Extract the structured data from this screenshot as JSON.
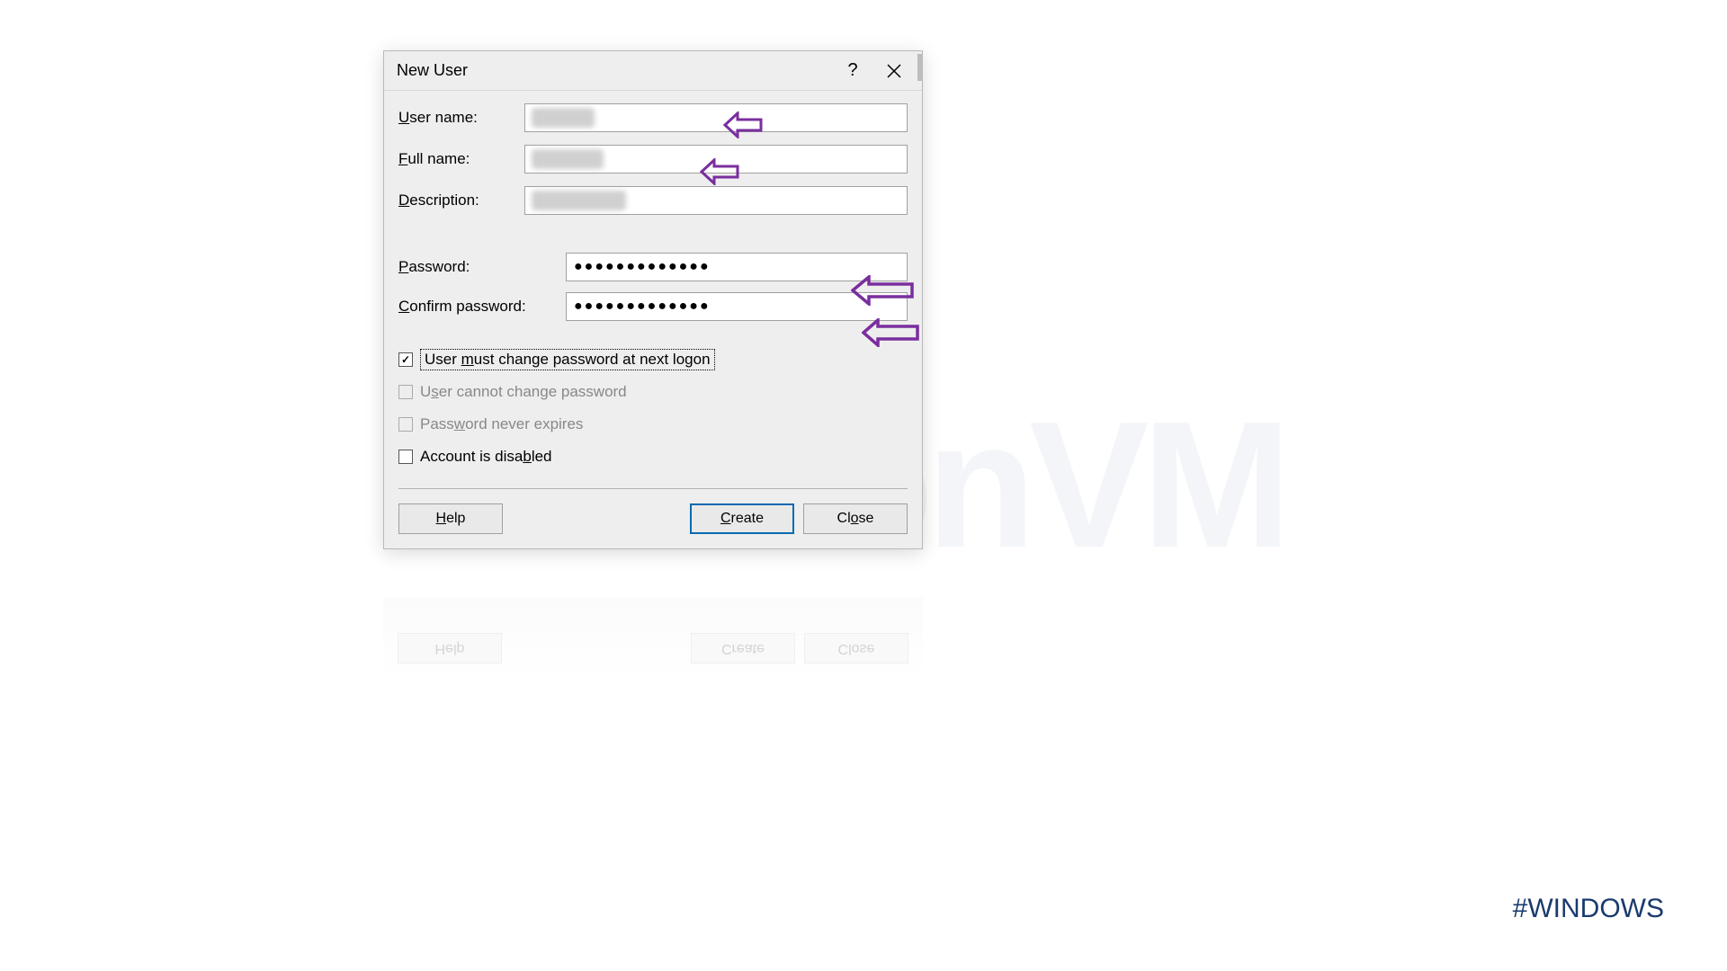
{
  "watermark": "NeuronVM",
  "hashtag": "#WINDOWS",
  "dialog": {
    "title": "New User",
    "fields": {
      "username_label": "User name:",
      "username_mnemonic": "U",
      "fullname_label": "Full name:",
      "fullname_mnemonic": "F",
      "description_label": "Description:",
      "description_mnemonic": "D",
      "password_label": "Password:",
      "password_mnemonic": "P",
      "confirm_label": "Confirm password:",
      "confirm_mnemonic": "C",
      "password_value": "●●●●●●●●●●●●●",
      "confirm_value": "●●●●●●●●●●●●●"
    },
    "checkboxes": {
      "must_change": {
        "label": "User must change password at next logon",
        "mnemonic": "m",
        "checked": true,
        "disabled": false,
        "focused": true
      },
      "cannot_change": {
        "label": "User cannot change password",
        "mnemonic": "s",
        "checked": false,
        "disabled": true
      },
      "never_expires": {
        "label": "Password never expires",
        "mnemonic": "w",
        "checked": false,
        "disabled": true
      },
      "disabled_acct": {
        "label": "Account is disabled",
        "mnemonic": "b",
        "checked": false,
        "disabled": false
      }
    },
    "buttons": {
      "help": "Help",
      "help_mnemonic": "H",
      "create": "Create",
      "create_mnemonic": "C",
      "close": "Close",
      "close_mnemonic": "o"
    }
  },
  "annotations": {
    "arrow_color": "#7a2e9e"
  }
}
